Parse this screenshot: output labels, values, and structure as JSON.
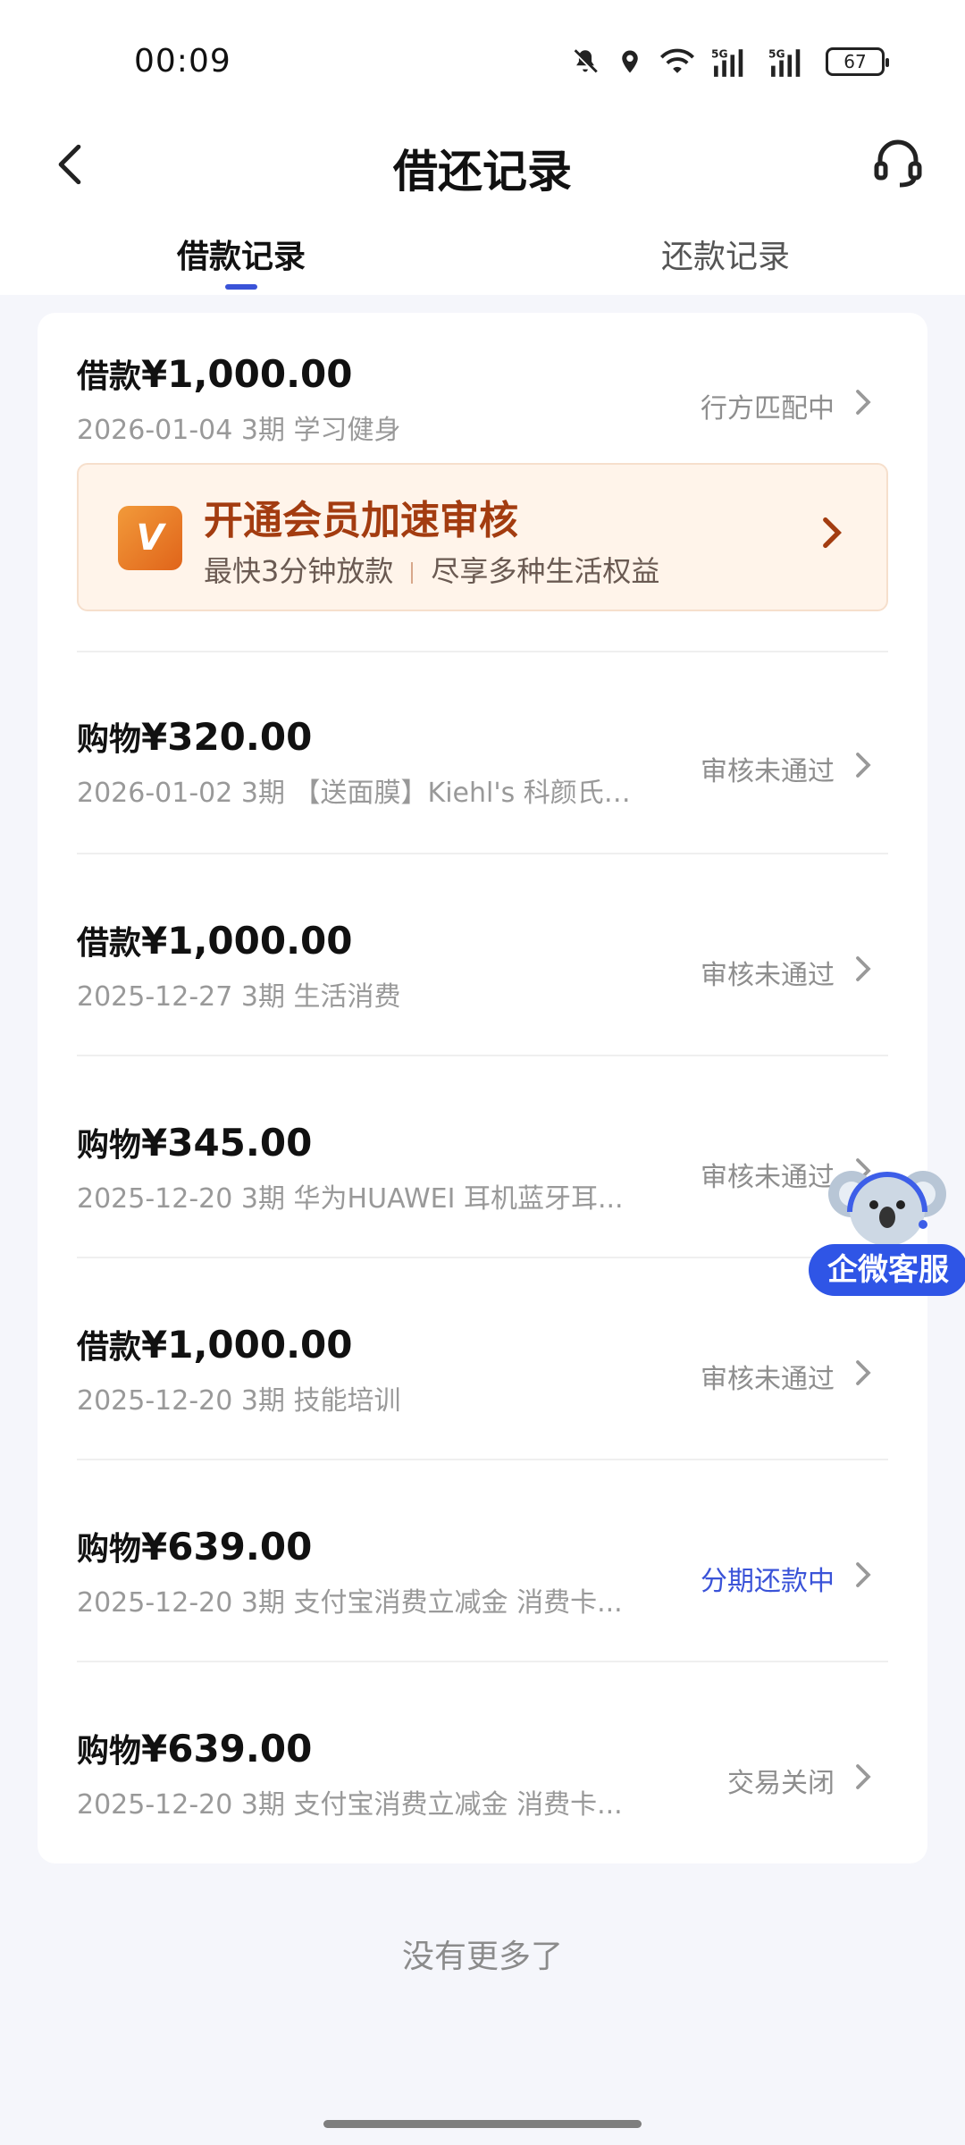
{
  "status_bar": {
    "time": "00:09",
    "battery": "67"
  },
  "header": {
    "title": "借还记录"
  },
  "tabs": [
    {
      "label": "借款记录",
      "active": true
    },
    {
      "label": "还款记录",
      "active": false
    }
  ],
  "records": [
    {
      "type": "借款",
      "amount": "¥1,000.00",
      "date": "2026-01-04",
      "term": "3期",
      "desc": "学习健身",
      "status": "行方匹配中",
      "status_color": "#8e8e8e"
    },
    {
      "type": "购物",
      "amount": "¥320.00",
      "date": "2026-01-02",
      "term": "3期",
      "desc": "【送面膜】Kiehl's 科颜氏 ...",
      "status": "审核未通过",
      "status_color": "#8e8e8e"
    },
    {
      "type": "借款",
      "amount": "¥1,000.00",
      "date": "2025-12-27",
      "term": "3期",
      "desc": "生活消费",
      "status": "审核未通过",
      "status_color": "#8e8e8e"
    },
    {
      "type": "购物",
      "amount": "¥345.00",
      "date": "2025-12-20",
      "term": "3期",
      "desc": "华为HUAWEI 耳机蓝牙耳...",
      "status": "审核未通过",
      "status_color": "#8e8e8e"
    },
    {
      "type": "借款",
      "amount": "¥1,000.00",
      "date": "2025-12-20",
      "term": "3期",
      "desc": "技能培训",
      "status": "审核未通过",
      "status_color": "#8e8e8e"
    },
    {
      "type": "购物",
      "amount": "¥639.00",
      "date": "2025-12-20",
      "term": "3期",
      "desc": "支付宝消费立减金 消费卡...",
      "status": "分期还款中",
      "status_color": "#3a53d8"
    },
    {
      "type": "购物",
      "amount": "¥639.00",
      "date": "2025-12-20",
      "term": "3期",
      "desc": "支付宝消费立减金 消费卡...",
      "status": "交易关闭",
      "status_color": "#8e8e8e"
    }
  ],
  "vip_banner": {
    "logo_text": "V",
    "title": "开通会员加速审核",
    "sub_left": "最快3分钟放款",
    "sub_right": "尽享多种生活权益"
  },
  "footer": {
    "no_more": "没有更多了"
  },
  "fab": {
    "label": "企微客服"
  },
  "colors": {
    "accent": "#3a53d8",
    "vip_title": "#a33c10",
    "fab": "#2f55e6"
  }
}
